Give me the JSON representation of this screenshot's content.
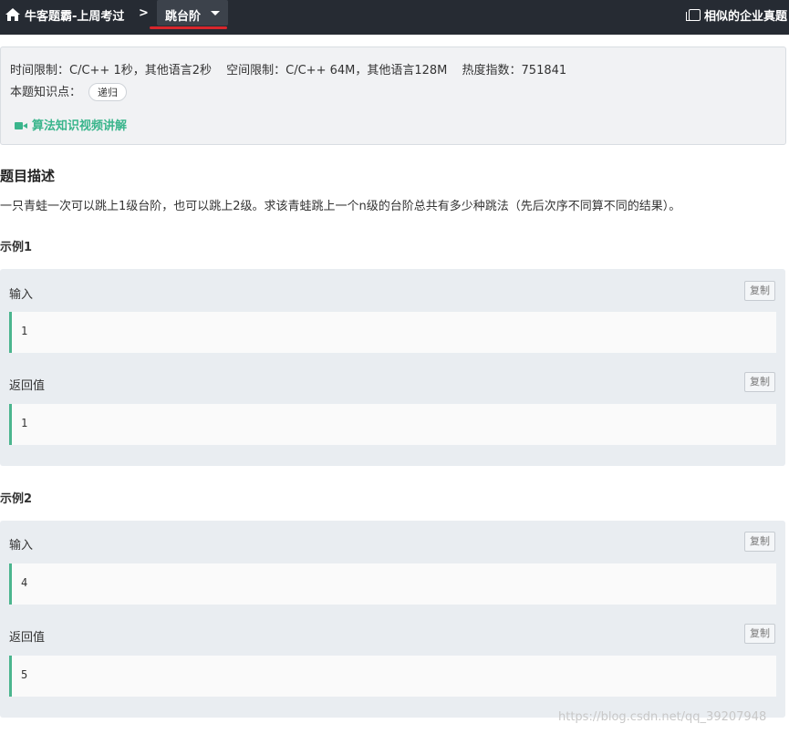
{
  "nav": {
    "parent_label": "牛客题霸-上周考过",
    "separator": ">",
    "current_label": "跳台阶",
    "similar_label": "相似的企业真题"
  },
  "info": {
    "time_limit": "时间限制：C/C++ 1秒，其他语言2秒",
    "space_limit": "空间限制：C/C++ 64M，其他语言128M",
    "heat": "热度指数：751841",
    "knowledge_label": "本题知识点：",
    "knowledge_tag": "递归",
    "video_link": "算法知识视频讲解"
  },
  "description": {
    "title": "题目描述",
    "text": "一只青蛙一次可以跳上1级台阶，也可以跳上2级。求该青蛙跳上一个n级的台阶总共有多少种跳法（先后次序不同算不同的结果）。"
  },
  "examples": [
    {
      "title": "示例1",
      "input_label": "输入",
      "input_value": "1",
      "output_label": "返回值",
      "output_value": "1",
      "copy_label": "复制"
    },
    {
      "title": "示例2",
      "input_label": "输入",
      "input_value": "4",
      "output_label": "返回值",
      "output_value": "5",
      "copy_label": "复制"
    }
  ],
  "watermark": "https://blog.csdn.net/qq_39207948",
  "colors": {
    "nav_bg": "#262b33",
    "accent_green": "#3ab58c",
    "underline_red": "#d9262c"
  },
  "icons": [
    "home-icon",
    "chevron-right-icon",
    "caret-down-icon",
    "copy-pages-icon",
    "video-camera-icon"
  ]
}
